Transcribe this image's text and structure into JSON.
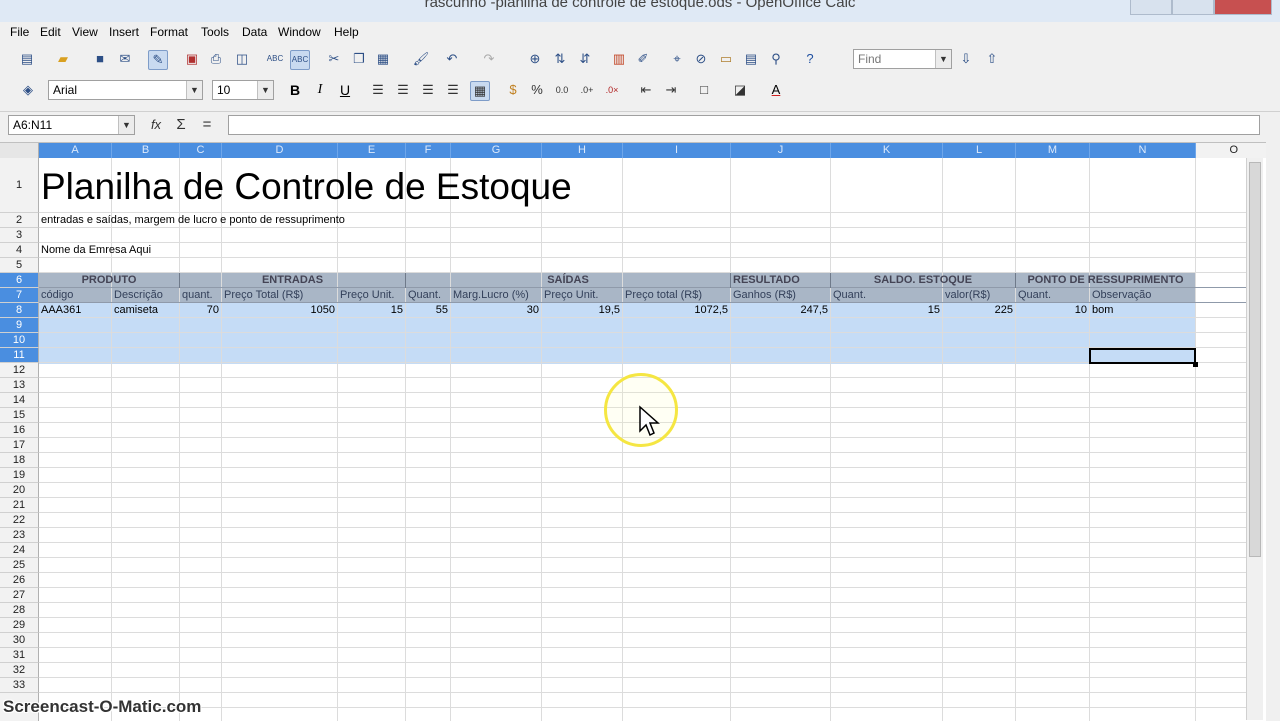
{
  "window": {
    "title": "rascunho -planilha de controle de estoque.ods - OpenOffice Calc"
  },
  "menu": [
    "File",
    "Edit",
    "View",
    "Insert",
    "Format",
    "Tools",
    "Data",
    "Window",
    "Help"
  ],
  "toolbar": {
    "find_placeholder": "Find",
    "font_name": "Arial",
    "font_size": "10",
    "bold": "B",
    "italic": "I",
    "underline": "U"
  },
  "formula_bar": {
    "name_box": "A6:N11",
    "function_wizard": "fx",
    "sum": "Σ",
    "equals": "=",
    "content": ""
  },
  "columns": [
    "A",
    "B",
    "C",
    "D",
    "E",
    "F",
    "G",
    "H",
    "I",
    "J",
    "K",
    "L",
    "M",
    "N",
    "O"
  ],
  "rows": [
    "1",
    "2",
    "3",
    "4",
    "5",
    "6",
    "7",
    "8",
    "9",
    "10",
    "11",
    "12",
    "13",
    "14",
    "15",
    "16",
    "17",
    "18",
    "19",
    "20",
    "21",
    "22",
    "23",
    "24",
    "25",
    "26",
    "27",
    "28",
    "29",
    "30",
    "31",
    "32",
    "33"
  ],
  "sheet": {
    "title": "Planilha de Controle de Estoque",
    "subtitle": "entradas e saídas, margem de lucro e ponto de ressuprimento",
    "company": "Nome da Emresa Aqui",
    "group_headers": [
      "PRODUTO",
      "ENTRADAS",
      "SAÍDAS",
      "RESULTADO",
      "SALDO. ESTOQUE",
      "PONTO DE RESSUPRIMENTO"
    ],
    "column_headers": [
      "código",
      "Descrição",
      "quant.",
      "Preço Total (R$)",
      "Preço Unit.",
      "Quant.",
      "Marg.Lucro (%)",
      "Preço Unit.",
      "Preço total (R$)",
      "Ganhos (R$)",
      "Quant.",
      "valor(R$)",
      "Quant.",
      "Observação"
    ],
    "data_row": [
      "AAA361",
      "camiseta",
      "70",
      "1050",
      "15",
      "55",
      "30",
      "19,5",
      "1072,5",
      "247,5",
      "15",
      "225",
      "10",
      "bom"
    ]
  },
  "watermark": "Screencast-O-Matic.com"
}
